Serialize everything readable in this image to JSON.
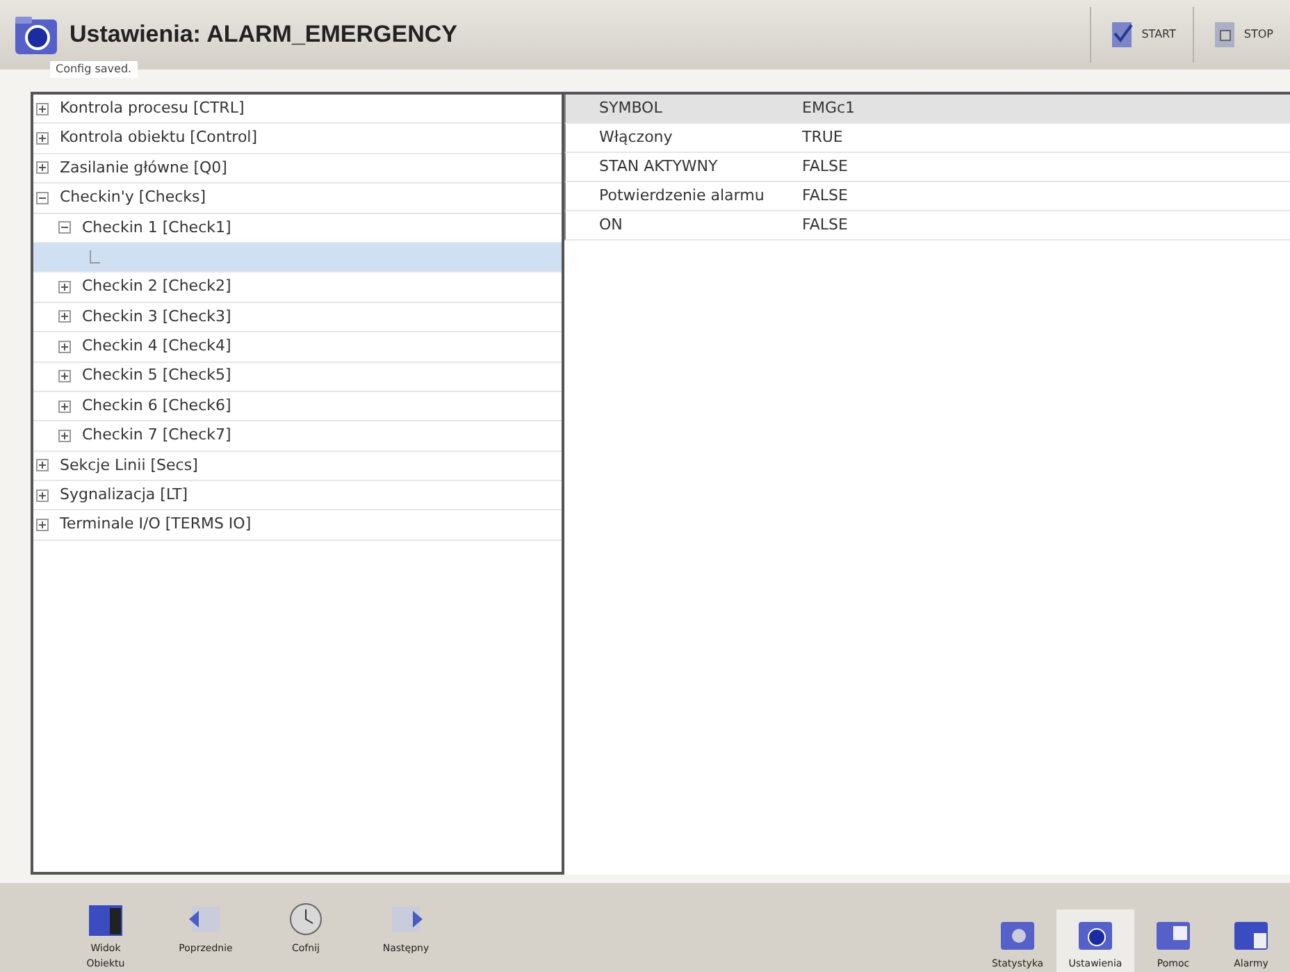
{
  "header": {
    "title": "Ustawienia: ALARM_EMERGENCY",
    "status": "Config saved.",
    "buttons": [
      {
        "label": "START",
        "kind": "start"
      },
      {
        "label": "STOP",
        "kind": "stop"
      }
    ]
  },
  "tree": [
    {
      "label": "Kontrola procesu [CTRL]",
      "expanded": false,
      "selected": false
    },
    {
      "label": "Kontrola obiektu [Control]",
      "expanded": false,
      "selected": false
    },
    {
      "label": "Zasilanie główne [Q0]",
      "expanded": false,
      "selected": false
    },
    {
      "label": "Checkin'y [Checks]",
      "expanded": true,
      "selected": false,
      "children": [
        {
          "label": "Checkin 1 [Check1]",
          "expanded": true,
          "selected": false,
          "children": [
            {
              "selected": true
            }
          ]
        },
        {
          "label": "Checkin 2 [Check2]",
          "expanded": false,
          "selected": false
        },
        {
          "label": "Checkin 3 [Check3]",
          "expanded": false,
          "selected": false
        },
        {
          "label": "Checkin 4 [Check4]",
          "expanded": false,
          "selected": false
        },
        {
          "label": "Checkin 5 [Check5]",
          "expanded": false,
          "selected": false
        },
        {
          "label": "Checkin 6 [Check6]",
          "expanded": false,
          "selected": false
        },
        {
          "label": "Checkin 7 [Check7]",
          "expanded": false,
          "selected": false
        }
      ]
    },
    {
      "label": "Sekcje Linii [Secs]",
      "expanded": false,
      "selected": false
    },
    {
      "label": "Sygnalizacja [LT]",
      "expanded": false,
      "selected": false
    },
    {
      "label": "Terminale I/O [TERMS IO]",
      "expanded": false,
      "selected": false
    }
  ],
  "properties": [
    {
      "name": "SYMBOL",
      "value": "EMGc1",
      "selected": true
    },
    {
      "name": "Włączony",
      "value": "TRUE",
      "selected": false
    },
    {
      "name": "STAN AKTYWNY",
      "value": "FALSE",
      "selected": false
    },
    {
      "name": "Potwierdzenie alarmu",
      "value": "FALSE",
      "selected": false
    },
    {
      "name": "ON",
      "value": "FALSE",
      "selected": false
    }
  ],
  "toolbar_left": [
    {
      "label": "Widok Obiektu",
      "kind": "view",
      "selected": false
    },
    {
      "label": "Poprzednie",
      "kind": "prev",
      "selected": false
    },
    {
      "label": "Cofnij",
      "kind": "undo",
      "selected": false
    },
    {
      "label": "Następny",
      "kind": "next",
      "selected": false
    }
  ],
  "toolbar_right": [
    {
      "label": "Statystyka",
      "kind": "stats",
      "selected": false
    },
    {
      "label": "Ustawienia",
      "kind": "settings",
      "selected": true
    },
    {
      "label": "Pomoc",
      "kind": "help",
      "selected": false
    },
    {
      "label": "Alarmy",
      "kind": "alarms",
      "selected": false
    }
  ]
}
